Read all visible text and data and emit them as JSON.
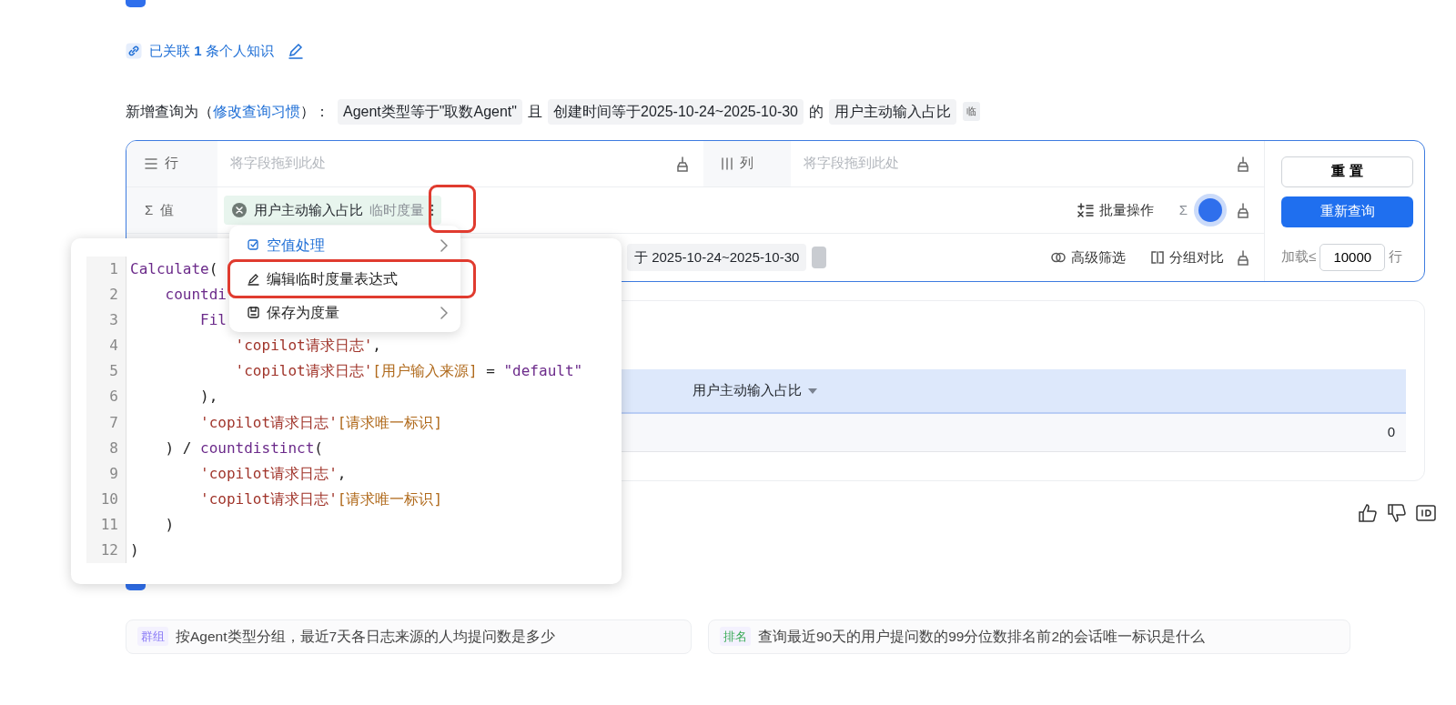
{
  "link_row": {
    "text": "已关联 **1** 条个人知识"
  },
  "query_line": {
    "prefix": "新增查询为（",
    "link": "修改查询习惯",
    "suffix": "）：",
    "tag": "临",
    "conditions": [
      {
        "text": "Agent类型等于\"取数Agent\"",
        "kind": "chip"
      },
      {
        "text": "且",
        "kind": "plain"
      },
      {
        "text": "创建时间等于2025-10-24~2025-10-30",
        "kind": "chip"
      },
      {
        "text": "的",
        "kind": "plain"
      },
      {
        "text": "用户主动输入占比",
        "kind": "chip"
      }
    ]
  },
  "pivot": {
    "rows_label": "行",
    "columns_label": "列",
    "values_symbol": "Σ",
    "values_label": "值",
    "row_placeholder": "将字段拖到此处",
    "column_placeholder": "将字段拖到此处",
    "value_chips": [
      {
        "name": "用户主动输入占比",
        "type": "临时度量",
        "annotated": true
      }
    ],
    "batch_label": "批量操作",
    "sum_symbol": "Σ",
    "filter_chips": [
      {
        "text": "于 2025-10-24~2025-10-30"
      }
    ],
    "advanced_filter": "高级筛选",
    "group_compare": "分组对比",
    "reset": "重 置",
    "requery": "重新查询",
    "load_label": "加载≤",
    "load_value": "10000",
    "load_unit": "行"
  },
  "menu": [
    {
      "label": "空值处理",
      "selected": true,
      "submenu": true,
      "annotated": false
    },
    {
      "label": "编辑临时度量表达式",
      "selected": false,
      "submenu": false,
      "annotated": true
    },
    {
      "label": "保存为度量",
      "selected": false,
      "submenu": true,
      "annotated": false
    }
  ],
  "code_lines": [
    {
      "number": "1",
      "tokens": [
        {
          "kind": "fn",
          "text": "Calculate"
        },
        {
          "kind": "plain",
          "text": "("
        }
      ]
    },
    {
      "number": "2",
      "tokens": [
        {
          "kind": "fn",
          "text": "    countdi"
        }
      ]
    },
    {
      "number": "3",
      "tokens": [
        {
          "kind": "fn",
          "text": "        Fil"
        }
      ]
    },
    {
      "number": "4",
      "tokens": [
        {
          "kind": "str",
          "text": "            'copilot请求日志'"
        },
        {
          "kind": "plain",
          "text": ","
        }
      ]
    },
    {
      "number": "5",
      "tokens": [
        {
          "kind": "str",
          "text": "            'copilot请求日志'"
        },
        {
          "kind": "field",
          "text": "[用户输入来源]"
        },
        {
          "kind": "plain",
          "text": " = "
        },
        {
          "kind": "literal",
          "text": "\"default\""
        }
      ]
    },
    {
      "number": "6",
      "tokens": [
        {
          "kind": "plain",
          "text": "        ),"
        }
      ]
    },
    {
      "number": "7",
      "tokens": [
        {
          "kind": "str",
          "text": "        'copilot请求日志'"
        },
        {
          "kind": "field",
          "text": "[请求唯一标识]"
        }
      ]
    },
    {
      "number": "8",
      "tokens": [
        {
          "kind": "plain",
          "text": "    ) / "
        },
        {
          "kind": "fn",
          "text": "countdistinct"
        },
        {
          "kind": "plain",
          "text": "("
        }
      ]
    },
    {
      "number": "9",
      "tokens": [
        {
          "kind": "str",
          "text": "        'copilot请求日志'"
        },
        {
          "kind": "plain",
          "text": ","
        }
      ]
    },
    {
      "number": "10",
      "tokens": [
        {
          "kind": "str",
          "text": "        'copilot请求日志'"
        },
        {
          "kind": "field",
          "text": "[请求唯一标识]"
        }
      ]
    },
    {
      "number": "11",
      "tokens": [
        {
          "kind": "plain",
          "text": "    )"
        }
      ]
    },
    {
      "number": "12",
      "tokens": [
        {
          "kind": "plain",
          "text": ")"
        }
      ]
    }
  ],
  "result_table": {
    "columns": [
      "用户主动输入占比"
    ],
    "rows": [
      [
        "0"
      ]
    ]
  },
  "recommended": [
    {
      "tag": "群组",
      "text": "按Agent类型分组，最近7天各日志来源的人均提问数是多少",
      "color": "#8b7cf6"
    },
    {
      "tag": "排名",
      "text": "查询最近90天的用户提问数的99分位数排名前2的会话唯一标识是什么",
      "color": "#34a853"
    }
  ]
}
